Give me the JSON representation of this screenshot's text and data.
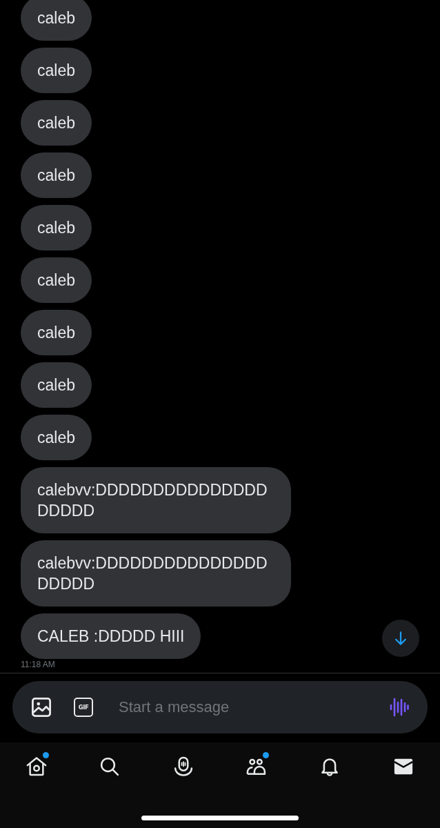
{
  "conversation": {
    "messages": [
      {
        "text": "caleb"
      },
      {
        "text": "caleb"
      },
      {
        "text": "caleb"
      },
      {
        "text": "caleb"
      },
      {
        "text": "caleb"
      },
      {
        "text": "caleb"
      },
      {
        "text": "caleb"
      },
      {
        "text": "caleb"
      },
      {
        "text": "caleb"
      },
      {
        "text": "calebvv:DDDDDDDDDDDDDDDDDDDD"
      },
      {
        "text": "calebvv:DDDDDDDDDDDDDDDDDDDD"
      },
      {
        "text": "CALEB :DDDDD HIII"
      }
    ],
    "timestamp": "11:18 AM"
  },
  "composer": {
    "gif_label": "GIF",
    "placeholder": "Start a message"
  },
  "nav": [
    {
      "kind": "home",
      "selected": false,
      "badge": true
    },
    {
      "kind": "search",
      "selected": false,
      "badge": false
    },
    {
      "kind": "spaces",
      "selected": false,
      "badge": false
    },
    {
      "kind": "communities",
      "selected": false,
      "badge": true
    },
    {
      "kind": "notifications",
      "selected": false,
      "badge": false
    },
    {
      "kind": "messages",
      "selected": true,
      "badge": false
    }
  ]
}
